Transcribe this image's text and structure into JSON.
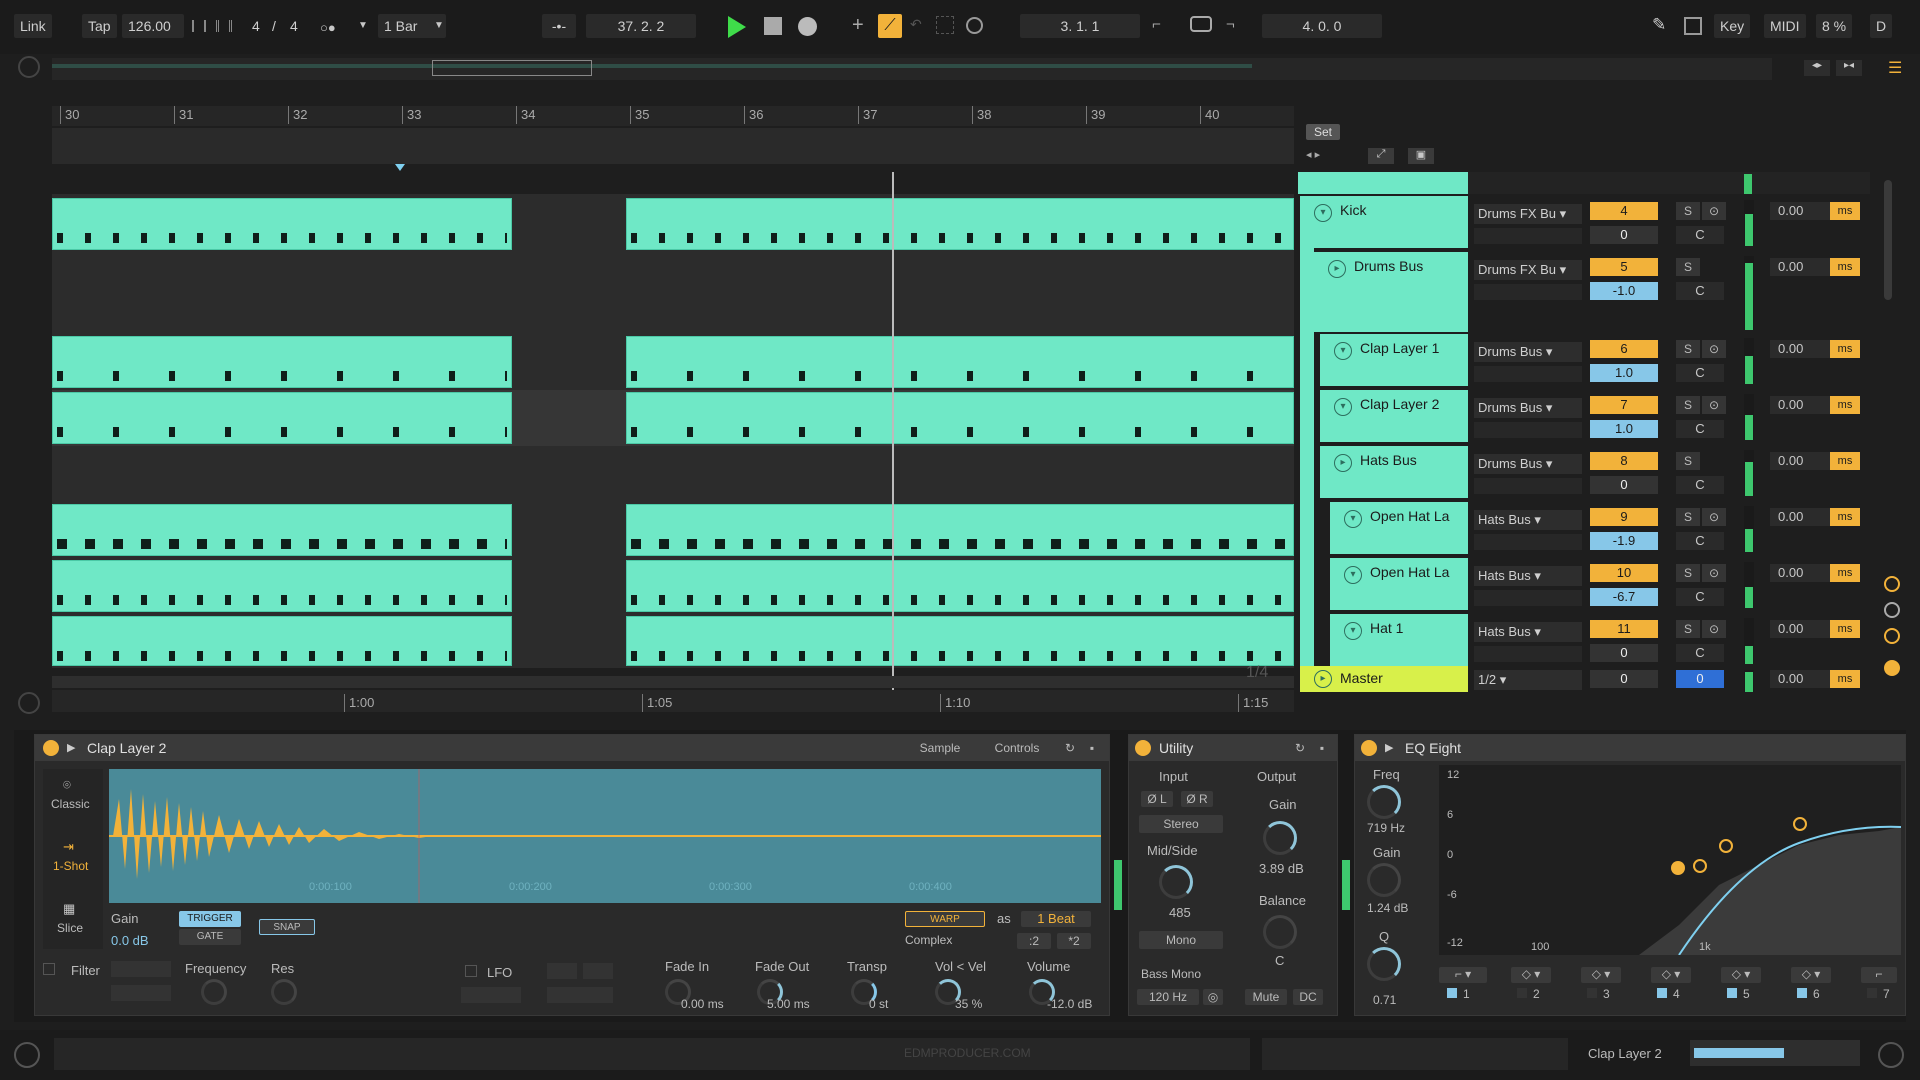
{
  "transport": {
    "link": "Link",
    "tap": "Tap",
    "tempo": "126.00",
    "signature_num": "4",
    "signature_sep": "/",
    "signature_den": "4",
    "quantize": "1 Bar",
    "position": "37.  2.  2",
    "loop_start": "3.  1.  1",
    "loop_length": "4.  0.  0",
    "key": "Key",
    "midi": "MIDI",
    "cpu": "8 %",
    "disk": "D"
  },
  "ruler": {
    "bars": [
      "30",
      "31",
      "32",
      "33",
      "34",
      "35",
      "36",
      "37",
      "38",
      "39",
      "40"
    ],
    "times": [
      "1:00",
      "1:05",
      "1:10",
      "1:15"
    ],
    "set_label": "Set",
    "zoom_label": "1/4"
  },
  "tracks": [
    {
      "name": "Kick",
      "route": "Drums FX Bu",
      "num": "4",
      "vol": "0",
      "pan": "C",
      "delay": "0.00"
    },
    {
      "name": "Drums Bus",
      "route": "Drums FX Bu",
      "num": "5",
      "vol": "-1.0",
      "pan": "C",
      "delay": "0.00"
    },
    {
      "name": "Clap Layer 1",
      "route": "Drums Bus",
      "num": "6",
      "vol": "1.0",
      "pan": "C",
      "delay": "0.00"
    },
    {
      "name": "Clap Layer 2",
      "route": "Drums Bus",
      "num": "7",
      "vol": "1.0",
      "pan": "C",
      "delay": "0.00"
    },
    {
      "name": "Hats Bus",
      "route": "Drums Bus",
      "num": "8",
      "vol": "0",
      "pan": "C",
      "delay": "0.00"
    },
    {
      "name": "Open Hat La",
      "route": "Hats Bus",
      "num": "9",
      "vol": "-1.9",
      "pan": "C",
      "delay": "0.00"
    },
    {
      "name": "Open Hat La",
      "route": "Hats Bus",
      "num": "10",
      "vol": "-6.7",
      "pan": "C",
      "delay": "0.00"
    },
    {
      "name": "Hat 1",
      "route": "Hats Bus",
      "num": "11",
      "vol": "0",
      "pan": "C",
      "delay": "0.00"
    }
  ],
  "master": {
    "name": "Master",
    "route": "1/2",
    "num": "0",
    "vol": "0",
    "delay": "0.00"
  },
  "mixer": {
    "solo": "S",
    "ms": "ms"
  },
  "simpler": {
    "title": "Clap Layer 2",
    "tab_sample": "Sample",
    "tab_controls": "Controls",
    "mode_classic": "Classic",
    "mode_oneshot": "1-Shot",
    "mode_slice": "Slice",
    "gain_label": "Gain",
    "gain": "0.0 dB",
    "trigger": "TRIGGER",
    "gate": "GATE",
    "snap": "SNAP",
    "warp": "WARP",
    "as": "as",
    "beat": "1 Beat",
    "complex": "Complex",
    "half": ":2",
    "double": "*2",
    "times": [
      "0:00:100",
      "0:00:200",
      "0:00:300",
      "0:00:400"
    ],
    "filter": "Filter",
    "frequency": "Frequency",
    "res": "Res",
    "lfo": "LFO",
    "fade_in_label": "Fade In",
    "fade_in": "0.00 ms",
    "fade_out_label": "Fade Out",
    "fade_out": "5.00 ms",
    "transp_label": "Transp",
    "transp": "0 st",
    "volvel_label": "Vol < Vel",
    "volvel": "35 %",
    "volume_label": "Volume",
    "volume": "-12.0 dB"
  },
  "utility": {
    "title": "Utility",
    "input": "Input",
    "output": "Output",
    "phase_l": "Ø L",
    "phase_r": "Ø R",
    "stereo": "Stereo",
    "gain_label": "Gain",
    "gain": "3.89 dB",
    "midside": "Mid/Side",
    "width": "485",
    "balance": "Balance",
    "balance_val": "C",
    "mono": "Mono",
    "bass_mono": "Bass Mono",
    "bass_freq": "120 Hz",
    "mute": "Mute",
    "dc": "DC"
  },
  "eq": {
    "title": "EQ Eight",
    "freq_label": "Freq",
    "freq": "719 Hz",
    "gain_label": "Gain",
    "gain": "1.24 dB",
    "q_label": "Q",
    "q": "0.71",
    "db": [
      "12",
      "6",
      "0",
      "-6",
      "-12"
    ],
    "hz": [
      "100",
      "1k"
    ],
    "bands": [
      "1",
      "2",
      "3",
      "4",
      "5",
      "6",
      "7"
    ]
  },
  "status": {
    "watermark": "EDMPRODUCER.COM",
    "track": "Clap Layer 2"
  },
  "colors": {
    "clip": "#6fe8c6",
    "accent": "#f2b23a",
    "master": "#d8f04a",
    "play": "#3fdc4a"
  }
}
